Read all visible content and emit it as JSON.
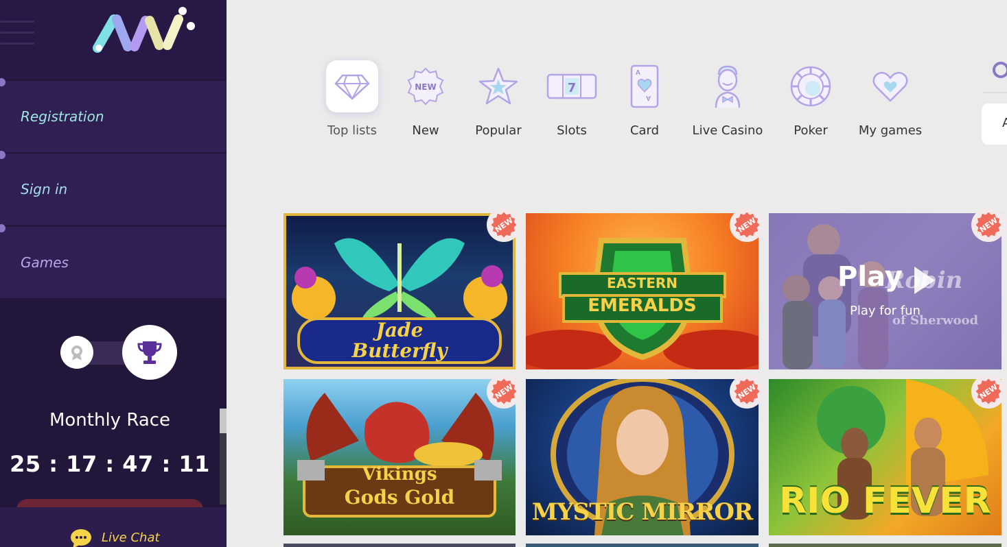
{
  "sidebar": {
    "nav": [
      {
        "label": "Registration"
      },
      {
        "label": "Sign in"
      },
      {
        "label": "Games"
      }
    ],
    "race": {
      "title": "Monthly Race",
      "timer": "25 : 17 : 47 : 11"
    },
    "live_chat": "Live Chat"
  },
  "categories": [
    {
      "label": "Top lists",
      "icon": "diamond-icon",
      "active": true
    },
    {
      "label": "New",
      "icon": "new-badge-icon",
      "active": false
    },
    {
      "label": "Popular",
      "icon": "star-icon",
      "active": false
    },
    {
      "label": "Slots",
      "icon": "slot-machine-icon",
      "active": false
    },
    {
      "label": "Card",
      "icon": "playing-card-icon",
      "active": false
    },
    {
      "label": "Live Casino",
      "icon": "dealer-icon",
      "active": false
    },
    {
      "label": "Poker",
      "icon": "poker-chip-icon",
      "active": false
    },
    {
      "label": "My games",
      "icon": "heart-icon",
      "active": false
    }
  ],
  "search": {
    "partial_text": "A"
  },
  "games": [
    {
      "title_line1": "Jade",
      "title_line2": "Butterfly",
      "badge": "NEW"
    },
    {
      "title_line1": "EASTERN",
      "title_line2": "EMERALDS",
      "badge": "NEW"
    },
    {
      "title_line1": "Robin",
      "title_line2": "of Sherwood",
      "badge": "NEW",
      "hover_play": "Play",
      "hover_fun": "Play for fun"
    },
    {
      "title_line1": "Vikings",
      "title_line2": "Gods Gold",
      "badge": "NEW"
    },
    {
      "title_line1": "MYSTIC MIRROR",
      "title_line2": "",
      "badge": "NEW"
    },
    {
      "title_line1": "RIO FEVER",
      "title_line2": "",
      "badge": "NEW"
    }
  ],
  "colors": {
    "sidebar_bg": "#22163a",
    "nav_bg": "#2f1f52",
    "accent_purple": "#8a78c4",
    "badge_red": "#f06a5a",
    "chat_yellow": "#f5d44a"
  }
}
